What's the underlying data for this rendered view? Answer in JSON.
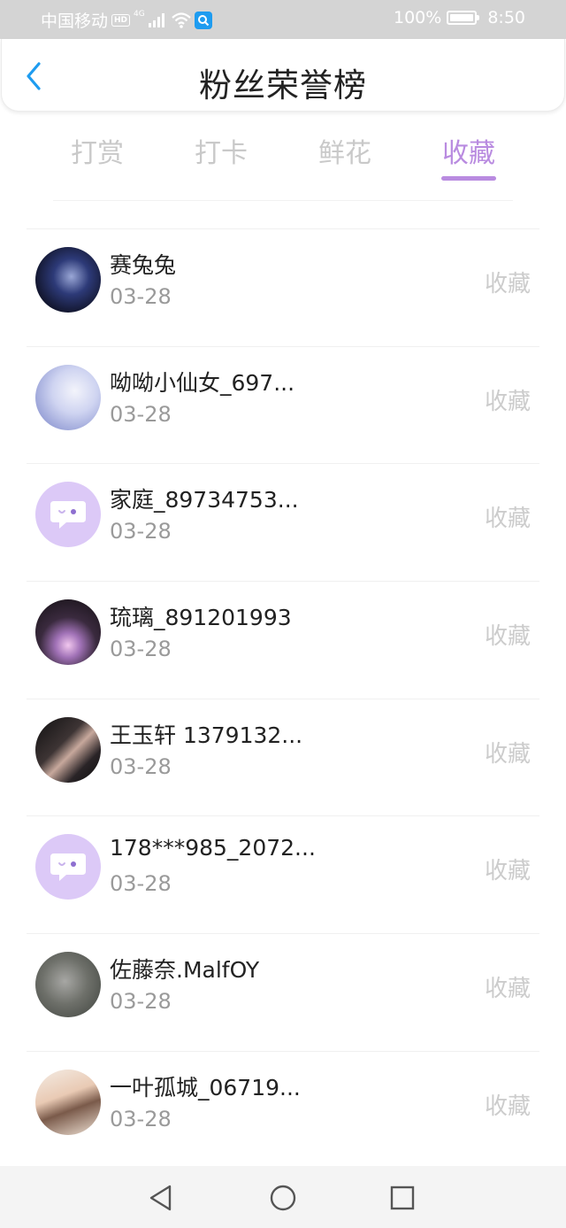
{
  "status_bar": {
    "carrier": "中国移动",
    "hd_badge": "HD",
    "network": "4G",
    "battery_percent": "100%",
    "time": "8:50"
  },
  "header": {
    "title": "粉丝荣誉榜",
    "back_icon": "chevron-left-icon"
  },
  "tabs": [
    {
      "label": "打赏",
      "active": false
    },
    {
      "label": "打卡",
      "active": false
    },
    {
      "label": "鲜花",
      "active": false
    },
    {
      "label": "收藏",
      "active": true
    }
  ],
  "colors": {
    "accent": "#b98be0",
    "back_icon": "#1e9cf0",
    "default_avatar": "#dcc9f7"
  },
  "fans": [
    {
      "name": "赛兔兔",
      "date": "03-28",
      "action": "收藏"
    },
    {
      "name": "呦呦小仙女_697...",
      "date": "03-28",
      "action": "收藏"
    },
    {
      "name": "家庭_89734753...",
      "date": "03-28",
      "action": "收藏"
    },
    {
      "name": "琉璃_891201993",
      "date": "03-28",
      "action": "收藏"
    },
    {
      "name": "王玉轩 1379132...",
      "date": "03-28",
      "action": "收藏"
    },
    {
      "name": "178***985_2072...",
      "date": "03-28",
      "action": "收藏"
    },
    {
      "name": "佐藤奈.MalfOY",
      "date": "03-28",
      "action": "收藏"
    },
    {
      "name": "一叶孤城_06719...",
      "date": "03-28",
      "action": "收藏"
    }
  ],
  "nav": {
    "back_icon": "triangle-back-icon",
    "home_icon": "circle-home-icon",
    "recents_icon": "square-recents-icon"
  }
}
